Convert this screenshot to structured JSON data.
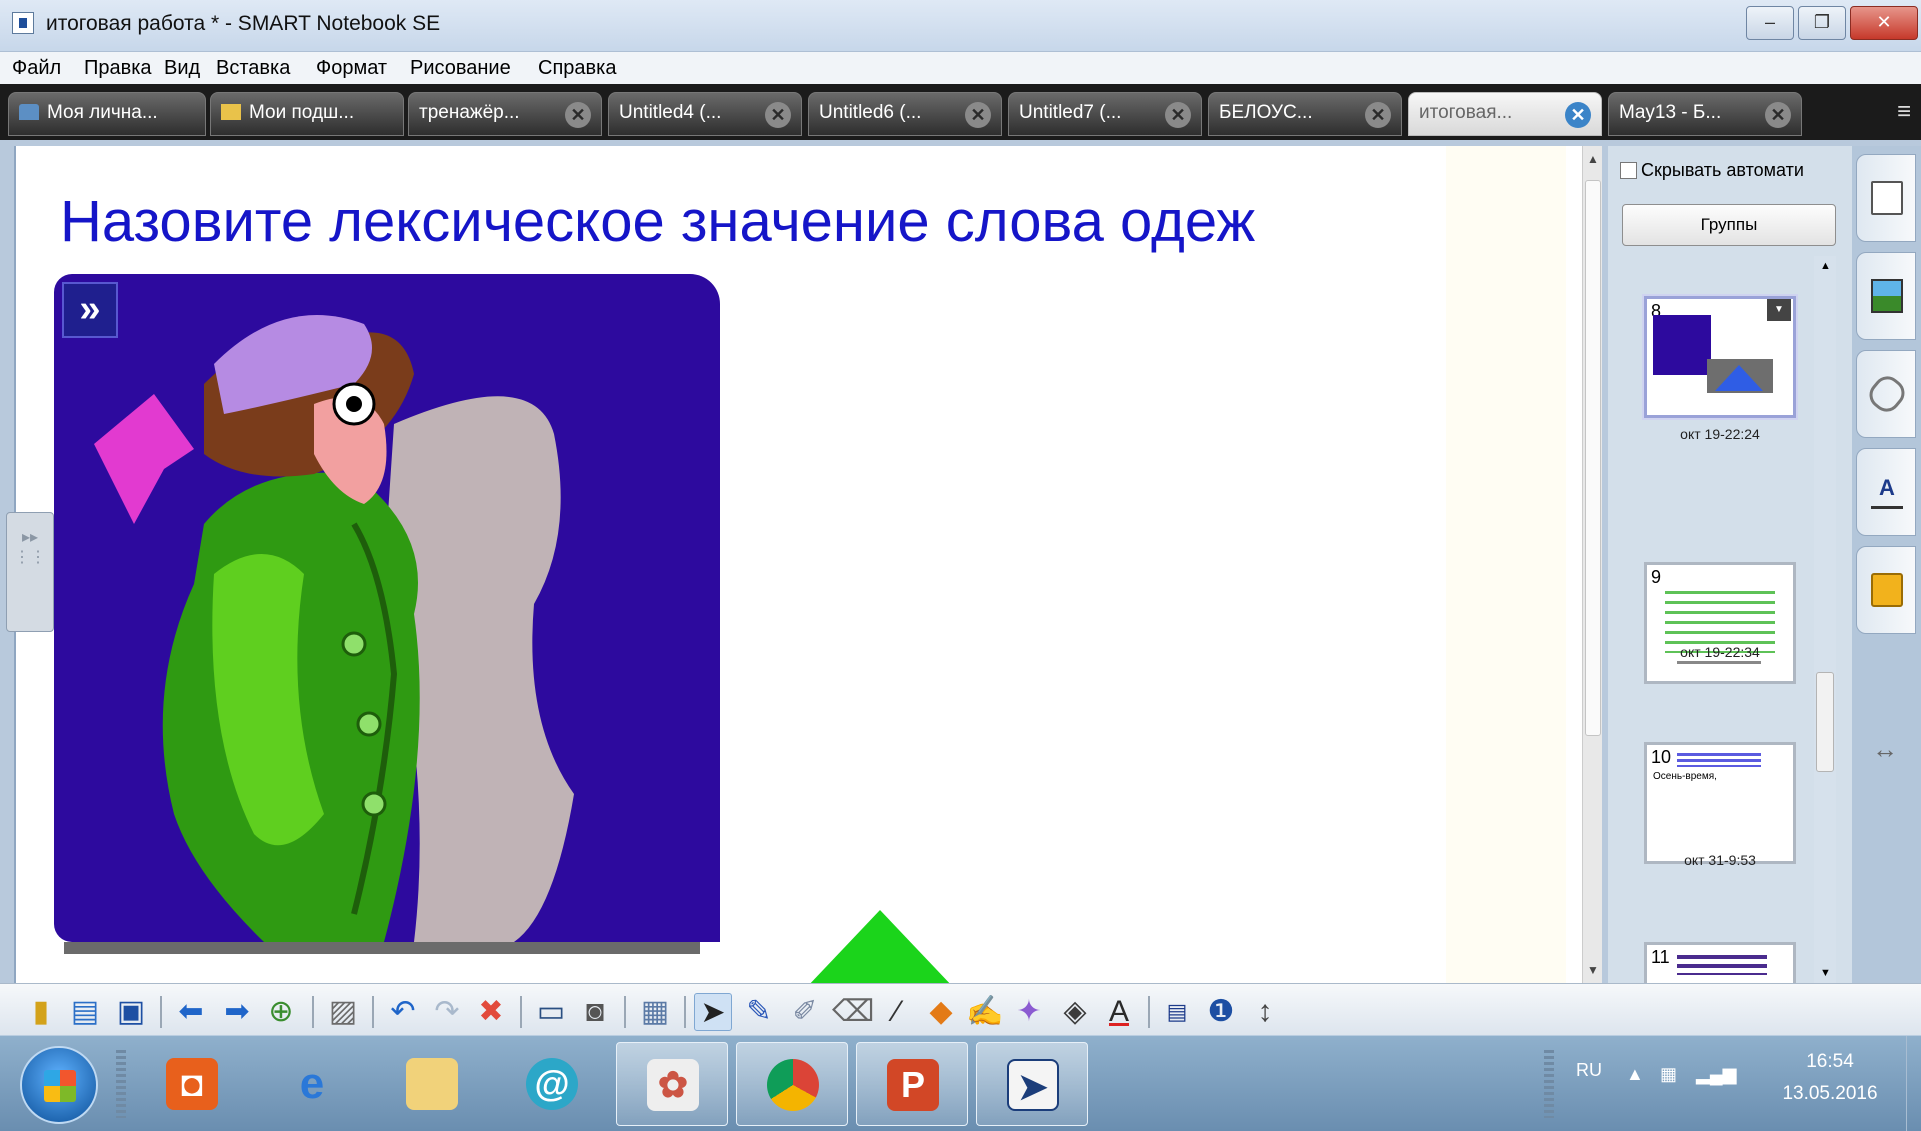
{
  "window": {
    "title": "итоговая работа * - SMART Notebook SE",
    "controls": {
      "minimize": "‒",
      "maximize": "❐",
      "close": "✕"
    }
  },
  "menu": [
    "Файл",
    "Правка",
    "Вид",
    "Вставка",
    "Формат",
    "Рисование",
    "Справка"
  ],
  "tabs": [
    {
      "label": "Моя лична...",
      "icon": "home-icon"
    },
    {
      "label": "Мои подш...",
      "icon": "folder-icon"
    },
    {
      "label": "тренажёр...",
      "icon": "close-icon"
    },
    {
      "label": "Untitled4 (...",
      "icon": "close-icon"
    },
    {
      "label": "Untitled6 (...",
      "icon": "close-icon"
    },
    {
      "label": "Untitled7 (...",
      "icon": "close-icon"
    },
    {
      "label": "БЕЛОУС...",
      "icon": "close-icon"
    },
    {
      "label": "итоговая...",
      "icon": "close-icon",
      "active": true
    },
    {
      "label": "May13 - Б...",
      "icon": "close-icon"
    }
  ],
  "page": {
    "heading": "Назовите лексическое значение слова одеж",
    "play_glyph": "»",
    "shape_glyph": "»"
  },
  "sorter": {
    "auto_hide_label": "Скрывать автомати",
    "groups_button": "Группы",
    "thumbnails": [
      {
        "number": "8",
        "time": "окт 19-22:24",
        "selected": true
      },
      {
        "number": "9",
        "time": "окт 19-22:34"
      },
      {
        "number": "10",
        "time": "окт 31-9:53",
        "text": "Осень-время,"
      },
      {
        "number": "11",
        "time": ""
      }
    ]
  },
  "right_tabs": [
    "page-sorter-icon",
    "gallery-icon",
    "attachments-icon",
    "properties-icon",
    "addons-icon"
  ],
  "toolbar_icons": [
    "new-page-icon",
    "open-icon",
    "save-icon",
    "back-icon",
    "forward-icon",
    "add-page-icon",
    "paste-icon",
    "undo-icon",
    "redo-icon",
    "delete-icon",
    "screen-shade-icon",
    "screen-capture-icon",
    "table-icon",
    "select-icon",
    "pen-icon",
    "creative-pen-icon",
    "eraser-icon",
    "line-icon",
    "shape-icon",
    "magic-pen-icon",
    "fill-icon",
    "text-icon",
    "properties-icon",
    "addons-icon",
    "move-toolbar-icon"
  ],
  "taskbar": {
    "apps": [
      "office-icon",
      "internet-explorer-icon",
      "file-explorer-icon",
      "mail-icon",
      "paint-icon",
      "chrome-icon",
      "powerpoint-icon",
      "smart-notebook-icon"
    ],
    "language": "RU",
    "time": "16:54",
    "date": "13.05.2016"
  }
}
